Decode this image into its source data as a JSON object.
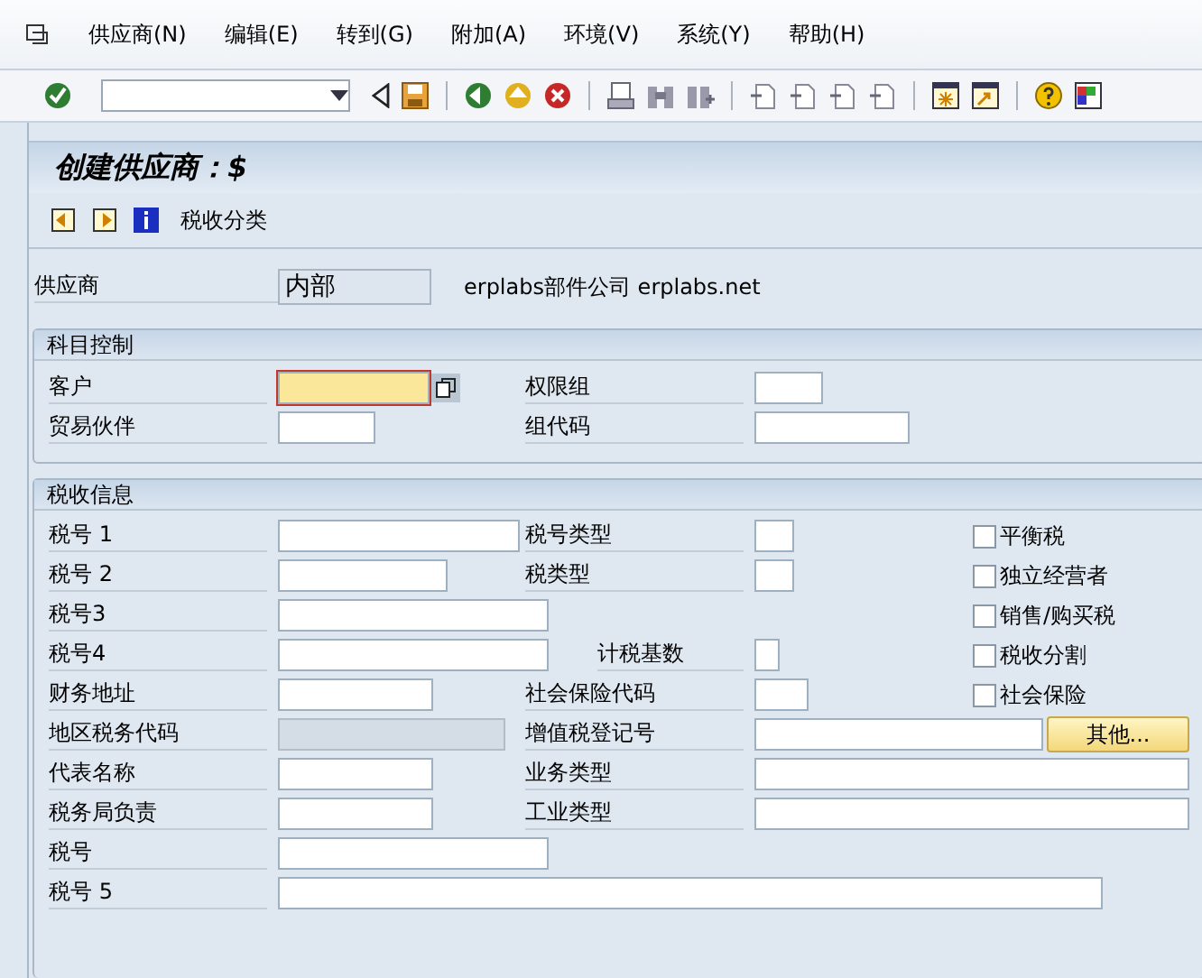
{
  "menu": [
    "供应商(N)",
    "编辑(E)",
    "转到(G)",
    "附加(A)",
    "环境(V)",
    "系统(Y)",
    "帮助(H)"
  ],
  "title": "创建供应商：$",
  "app_toolbar": {
    "button_label": "税收分类"
  },
  "vendor": {
    "label": "供应商",
    "value": "内部",
    "description": "erplabs部件公司 erplabs.net"
  },
  "account_control": {
    "title": "科目控制",
    "rows": [
      {
        "left": {
          "label": "客户",
          "focused": true,
          "search_help": true
        },
        "middle": {
          "label": "权限组"
        }
      },
      {
        "left": {
          "label": "贸易伙伴",
          "focused": false,
          "search_help": false
        },
        "middle": {
          "label": "组代码"
        }
      }
    ]
  },
  "tax_info": {
    "title": "税收信息",
    "rows": [
      {
        "left": {
          "label": "税号 1",
          "disabled": false
        },
        "middle": {
          "label": "税号类型"
        },
        "checkbox": {
          "label": "平衡税",
          "checked": false
        }
      },
      {
        "left": {
          "label": "税号 2",
          "disabled": false
        },
        "middle": {
          "label": "税类型"
        },
        "checkbox": {
          "label": "独立经营者",
          "checked": false
        }
      },
      {
        "left": {
          "label": "税号3",
          "disabled": false
        },
        "checkbox": {
          "label": "销售/购买税",
          "checked": false
        }
      },
      {
        "left": {
          "label": "税号4",
          "disabled": false
        },
        "middle": {
          "label": "计税基数"
        },
        "checkbox": {
          "label": "税收分割",
          "checked": false
        }
      },
      {
        "left": {
          "label": "财务地址",
          "disabled": false
        },
        "middle": {
          "label": "社会保险代码"
        },
        "checkbox": {
          "label": "社会保险",
          "checked": false
        }
      },
      {
        "left": {
          "label": "地区税务代码",
          "disabled": true
        },
        "middle": {
          "label": "增值税登记号",
          "button": "其他..."
        }
      },
      {
        "left": {
          "label": "代表名称",
          "disabled": false
        },
        "middle": {
          "label": "业务类型"
        }
      },
      {
        "left": {
          "label": "税务局负责",
          "disabled": false
        },
        "middle": {
          "label": "工业类型"
        }
      },
      {
        "left": {
          "label": "税号",
          "disabled": false
        }
      },
      {
        "left": {
          "label": "税号 5",
          "disabled": false
        }
      }
    ]
  }
}
